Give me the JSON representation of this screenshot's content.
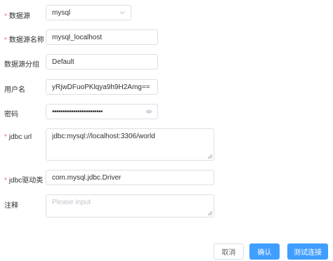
{
  "form": {
    "datasource": {
      "label": "数据源",
      "required": true,
      "value": "mysql",
      "icon": "chevron-down-icon"
    },
    "datasource_name": {
      "label": "数据源名称",
      "required": true,
      "value": "mysql_localhost"
    },
    "datasource_group": {
      "label": "数据源分组",
      "required": false,
      "value": "Default"
    },
    "username": {
      "label": "用户名",
      "required": false,
      "value": "yRjwDFuoPKlqya9h9H2Amg=="
    },
    "password": {
      "label": "密码",
      "required": false,
      "value": "••••••••••••••••••••••••",
      "icon": "eye-icon"
    },
    "jdbc_url": {
      "label": "jdbc url",
      "required": true,
      "value": "jdbc:mysql://localhost:3306/world"
    },
    "jdbc_driver": {
      "label": "jdbc驱动类",
      "required": true,
      "value": "com.mysql.jdbc.Driver"
    },
    "remarks": {
      "label": "注释",
      "required": false,
      "value": "",
      "placeholder": "Please input"
    }
  },
  "footer": {
    "cancel_label": "取消",
    "confirm_label": "确认",
    "test_label": "测试连接"
  },
  "colors": {
    "required": "#f56c6c",
    "primary": "#409eff",
    "border": "#dcdfe6"
  }
}
